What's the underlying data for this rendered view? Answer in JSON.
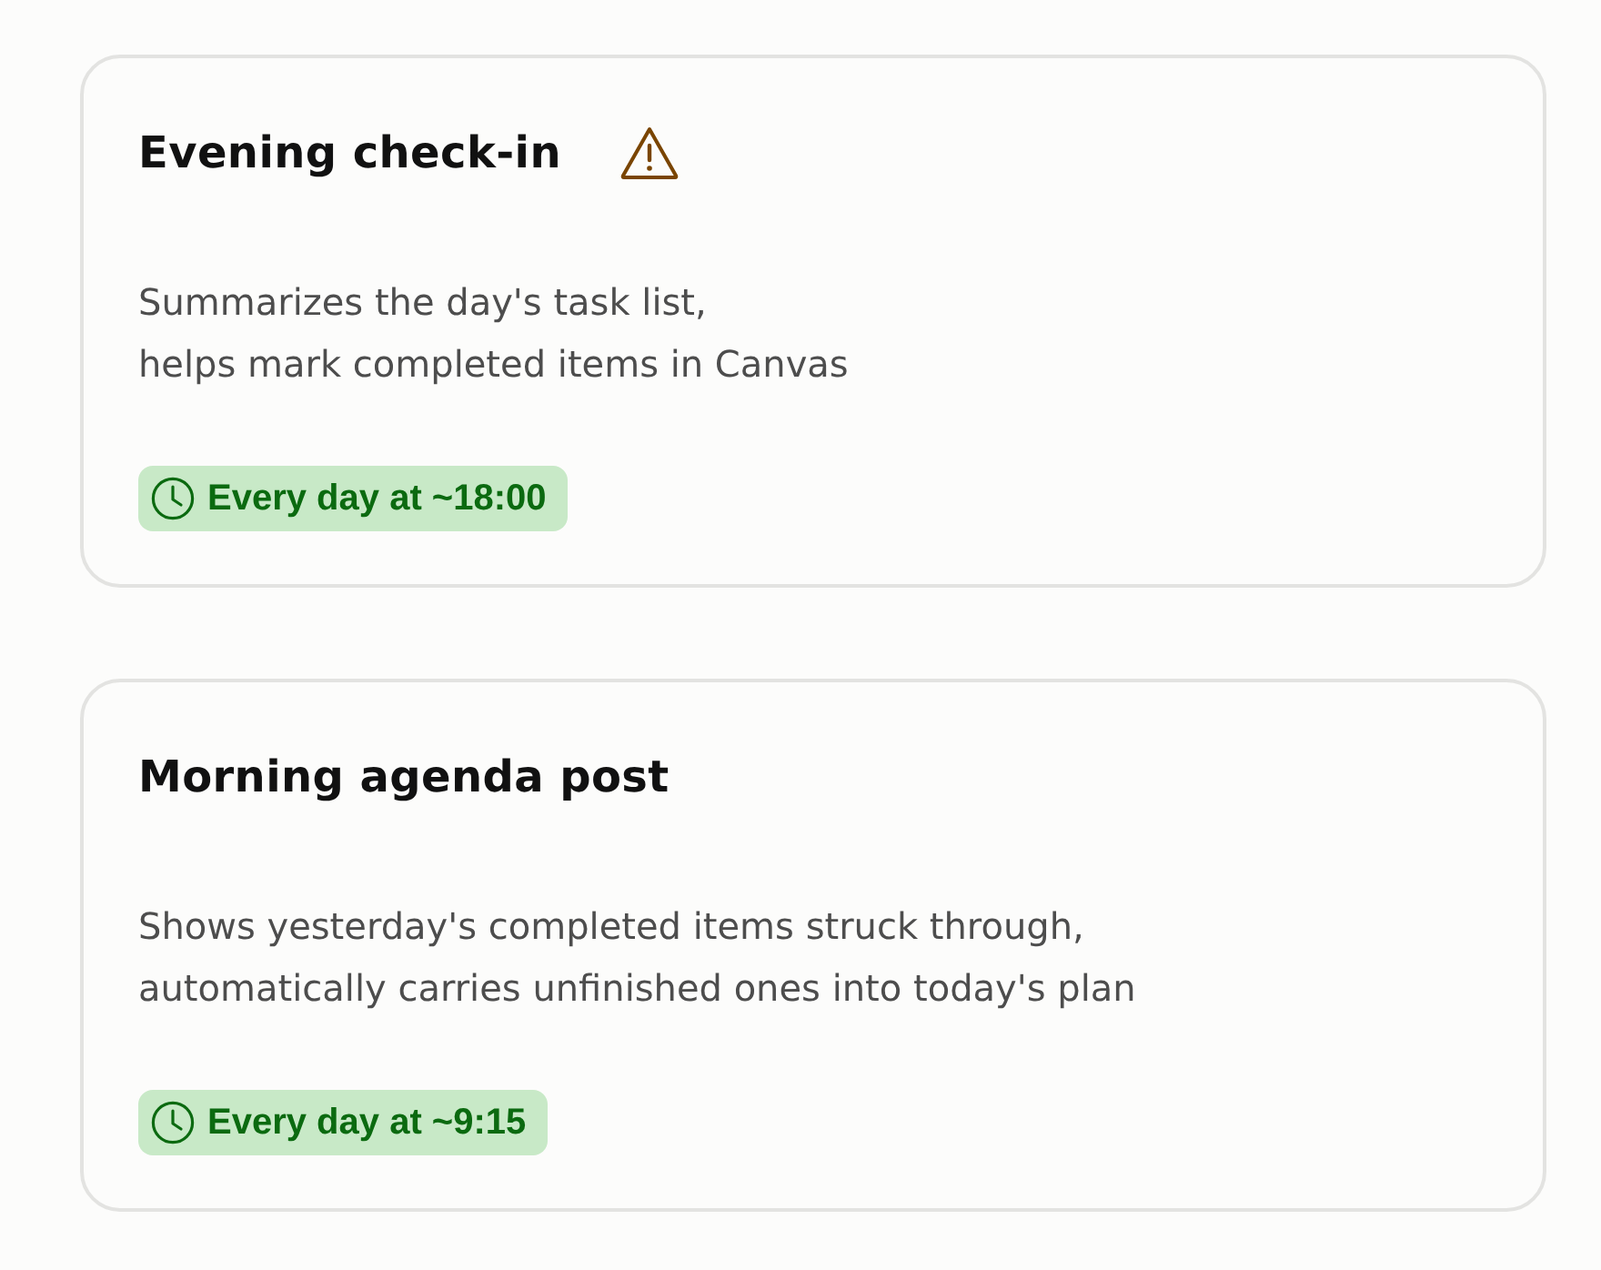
{
  "cards": [
    {
      "title": "Evening check-in",
      "warning": true,
      "description": [
        "Summarizes the day's task list,",
        "helps mark completed items in Canvas"
      ],
      "schedule": "Every day at ~18:00"
    },
    {
      "title": "Morning agenda post",
      "warning": false,
      "description": [
        "Shows yesterday's completed items struck through,",
        "automatically carries unfinished ones into today's plan"
      ],
      "schedule": "Every day at ~9:15"
    }
  ]
}
